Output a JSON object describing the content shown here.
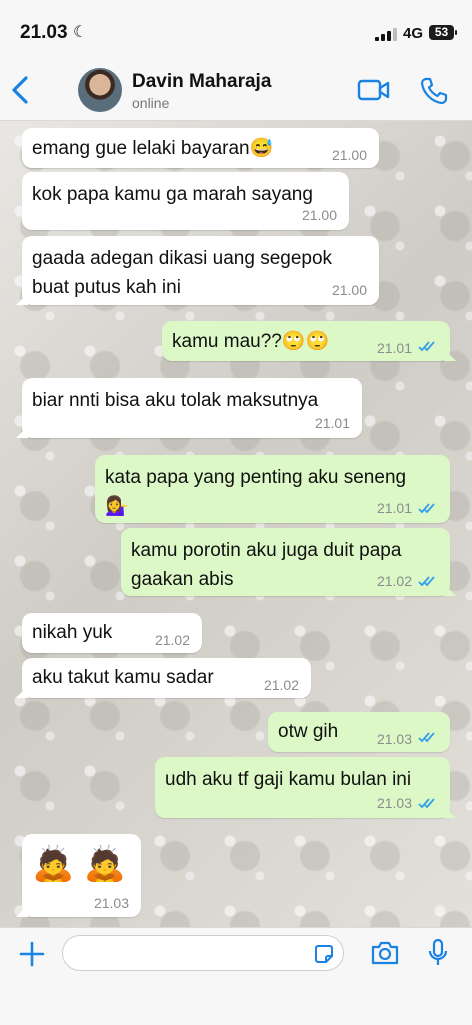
{
  "status_bar": {
    "time": "21.03",
    "network": "4G",
    "battery": "53"
  },
  "header": {
    "contact_name": "Davin Maharaja",
    "contact_status": "online"
  },
  "colors": {
    "accent": "#1a82e2",
    "outgoing_bubble": "#dcf8c6",
    "incoming_bubble": "#ffffff",
    "read_tick": "#34a0e8"
  },
  "messages": [
    {
      "direction": "in",
      "text": "emang gue lelaki bayaran😅",
      "time": "21.00"
    },
    {
      "direction": "in",
      "text": "kok papa kamu ga marah sayang",
      "time": "21.00"
    },
    {
      "direction": "in",
      "text": "gaada adegan dikasi uang segepok\nbuat putus kah ini",
      "time": "21.00"
    },
    {
      "direction": "out",
      "text": "kamu mau??🙄🙄",
      "time": "21.01",
      "status": "read"
    },
    {
      "direction": "in",
      "text": "biar nnti bisa aku tolak maksutnya",
      "time": "21.01"
    },
    {
      "direction": "out",
      "text": "kata papa yang penting aku seneng\n💁‍♀️",
      "time": "21.01",
      "status": "read"
    },
    {
      "direction": "out",
      "text": "kamu porotin aku juga duit papa\ngaakan abis",
      "time": "21.02",
      "status": "read"
    },
    {
      "direction": "in",
      "text": "nikah yuk",
      "time": "21.02"
    },
    {
      "direction": "in",
      "text": "aku takut kamu sadar",
      "time": "21.02"
    },
    {
      "direction": "out",
      "text": "otw gih",
      "time": "21.03",
      "status": "read"
    },
    {
      "direction": "out",
      "text": "udh aku tf gaji kamu bulan ini",
      "time": "21.03",
      "status": "read"
    },
    {
      "direction": "in",
      "text": "🙇 🙇",
      "time": "21.03"
    }
  ],
  "input": {
    "placeholder": "",
    "value": ""
  },
  "icons": [
    "moon-icon",
    "signal-icon",
    "back-chevron-icon",
    "video-call-icon",
    "phone-icon",
    "read-ticks-icon",
    "plus-icon",
    "sticker-icon",
    "camera-icon",
    "microphone-icon"
  ]
}
